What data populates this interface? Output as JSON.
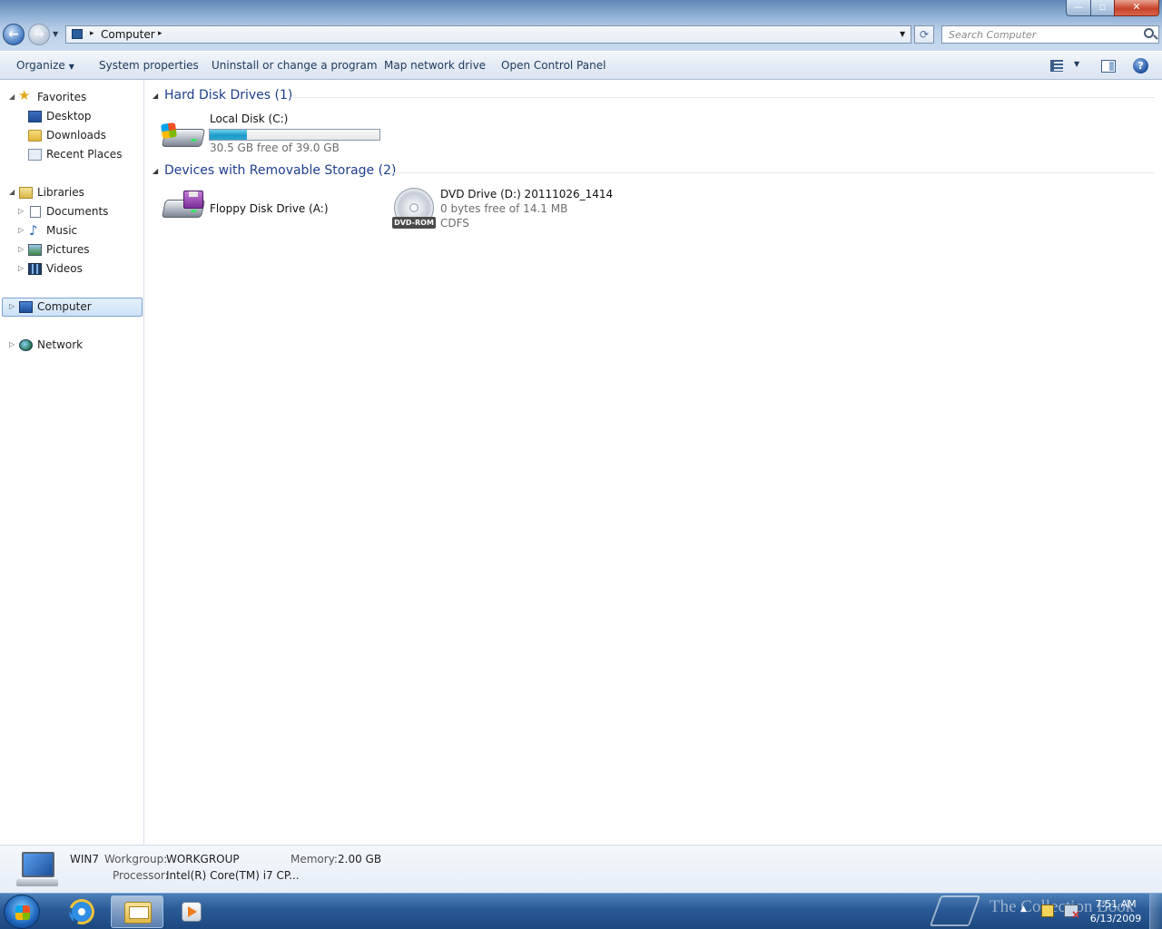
{
  "window": {
    "controls": {
      "minimize": "—",
      "maximize": "▫",
      "close": "✕"
    }
  },
  "nav_buttons": {
    "back": "←",
    "forward": "→",
    "history": "▼"
  },
  "address": {
    "location": "Computer",
    "separator": "▸",
    "dropdown": "▼",
    "refresh": "⟳"
  },
  "search": {
    "placeholder": "Search Computer"
  },
  "commandbar": {
    "organize": "Organize",
    "organize_dd": "▼",
    "system_properties": "System properties",
    "uninstall": "Uninstall or change a program",
    "map_network": "Map network drive",
    "open_control_panel": "Open Control Panel",
    "views_dd": "▼",
    "help": "?"
  },
  "navigation": {
    "expanded": "◢",
    "collapsed": "▷",
    "favorites": {
      "label": "Favorites",
      "icon": "★"
    },
    "favorite_items": [
      "Desktop",
      "Downloads",
      "Recent Places"
    ],
    "libraries": {
      "label": "Libraries"
    },
    "library_items": [
      "Documents",
      "Music",
      "Pictures",
      "Videos"
    ],
    "music_icon": "♪",
    "computer": {
      "label": "Computer",
      "selected": true
    },
    "network": {
      "label": "Network"
    }
  },
  "content": {
    "group_tri": "◢",
    "groups": [
      {
        "title": "Hard Disk Drives (1)",
        "drives": [
          {
            "name": "Local Disk (C:)",
            "free_text": "30.5 GB free of 39.0 GB",
            "used_fraction": 0.218
          }
        ]
      },
      {
        "title": "Devices with Removable Storage (2)",
        "drives": [
          {
            "name": "Floppy Disk Drive (A:)"
          },
          {
            "name": "DVD Drive (D:) 20111026_1414",
            "free_text": "0 bytes free of 14.1 MB",
            "filesystem": "CDFS",
            "badge": "DVD-ROM"
          }
        ]
      }
    ]
  },
  "details": {
    "computer_name": "WIN7",
    "workgroup_label": "Workgroup:",
    "workgroup_value": "WORKGROUP",
    "memory_label": "Memory:",
    "memory_value": "2.00 GB",
    "processor_label": "Processor:",
    "processor_value": "Intel(R) Core(TM) i7 CP..."
  },
  "taskbar": {
    "tray_show_hidden": "▲",
    "clock_time": "7:51 AM",
    "clock_date": "6/13/2009",
    "watermark": "The Collection Book"
  },
  "colors": {
    "group_header": "#1e3e8c",
    "usage_bar": "#1d9ac6",
    "selection": "#cde3f8",
    "taskbar": "#2a5a95"
  }
}
